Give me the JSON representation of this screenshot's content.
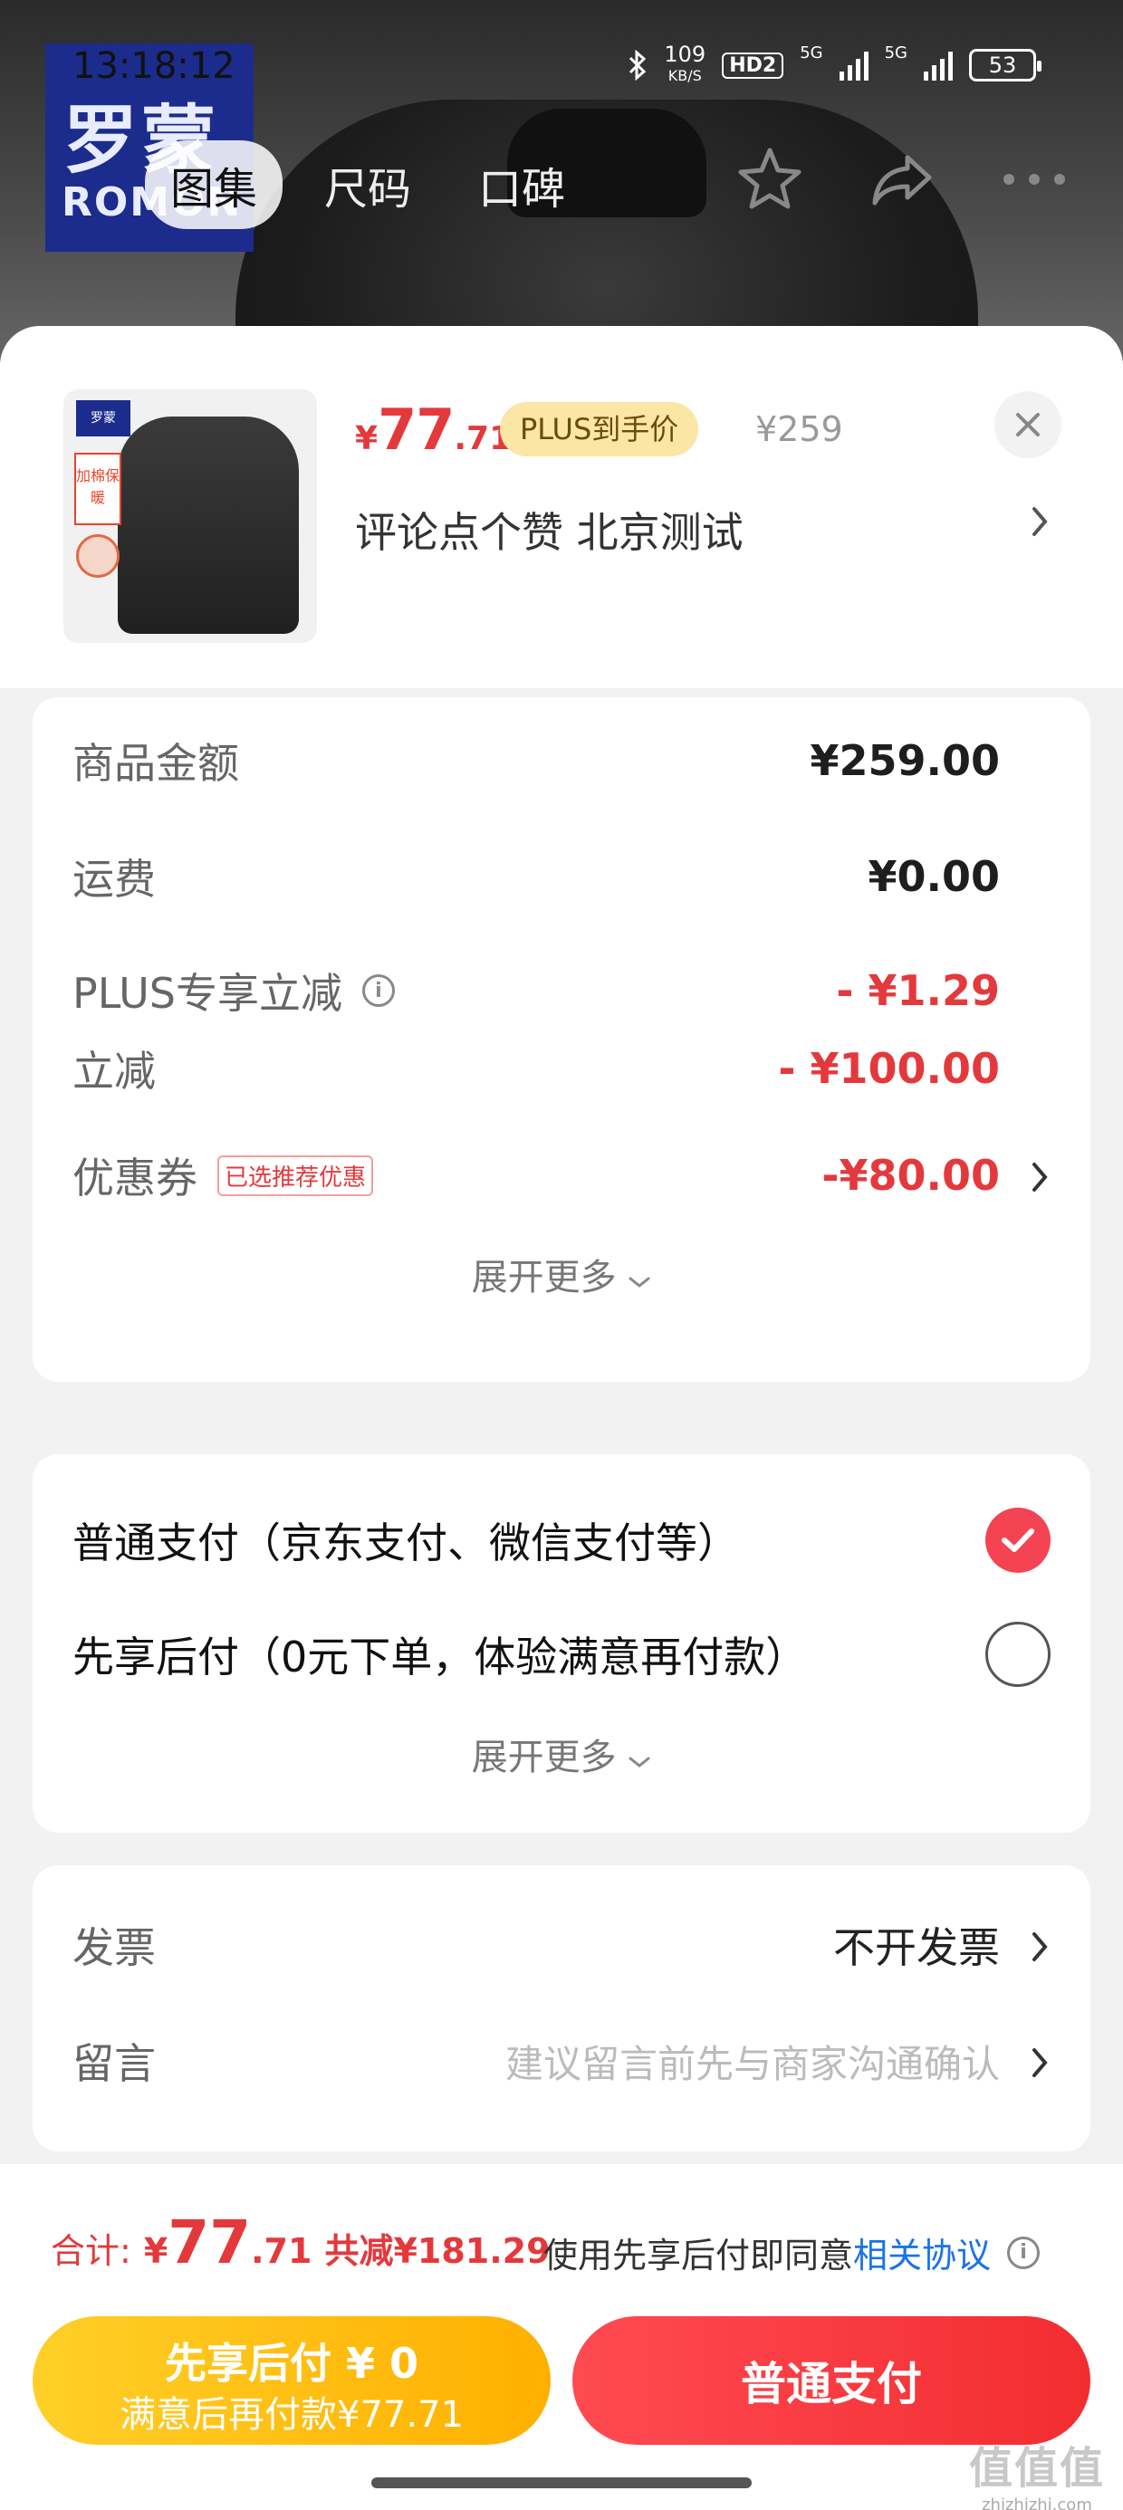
{
  "status_bar": {
    "time": "13:18:12",
    "net_speed": "109",
    "net_unit": "KB/S",
    "hd": "HD2",
    "sig1": "5G",
    "sig2": "5G",
    "battery": "53"
  },
  "brand": {
    "cn": "罗蒙",
    "en": "ROMON"
  },
  "top_tabs": [
    {
      "label": "图集"
    },
    {
      "label": "尺码"
    },
    {
      "label": "口碑"
    }
  ],
  "product": {
    "thumb_logo": "罗蒙",
    "thumb_tag": "加棉保暖",
    "price_symbol": "¥",
    "price_int": "77",
    "price_dec": ".71",
    "plus_label": "PLUS到手价",
    "original_price": "¥259",
    "title": "评论点个赞  北京测试"
  },
  "amounts": {
    "rows": [
      {
        "label": "商品金额",
        "value": "¥259.00"
      },
      {
        "label": "运费",
        "value": "¥0.00"
      },
      {
        "label": "PLUS专享立减",
        "value": "- ¥1.29"
      },
      {
        "label": "立减",
        "value": "- ¥100.00"
      },
      {
        "label": "优惠券",
        "tag": "已选推荐优惠",
        "value": "-¥80.00"
      }
    ],
    "expand_label": "展开更多"
  },
  "payment": {
    "options": [
      {
        "label": "普通支付（京东支付、微信支付等）",
        "selected": true
      },
      {
        "label": "先享后付（0元下单，体验满意再付款）",
        "selected": false
      }
    ],
    "expand_label": "展开更多"
  },
  "extra": {
    "invoice_label": "发票",
    "invoice_value": "不开发票",
    "message_label": "留言",
    "message_placeholder": "建议留言前先与商家沟通确认"
  },
  "bottom": {
    "total_label": "合计:",
    "total_symbol": "¥",
    "total_int": "77",
    "total_dec": ".71",
    "saved": "共减¥181.29",
    "agree_prefix": "使用先享后付即同意",
    "agree_link": "相关协议",
    "later_line1": "先享后付 ¥ 0",
    "later_line2": "满意后再付款¥77.71",
    "pay_label": "普通支付"
  },
  "watermark": {
    "main": "值值值",
    "sub": "zhizhizhi.com"
  },
  "colors": {
    "accent_red": "#e4393c",
    "yellow_btn": "#ffb000",
    "link_blue": "#1a73e8"
  }
}
